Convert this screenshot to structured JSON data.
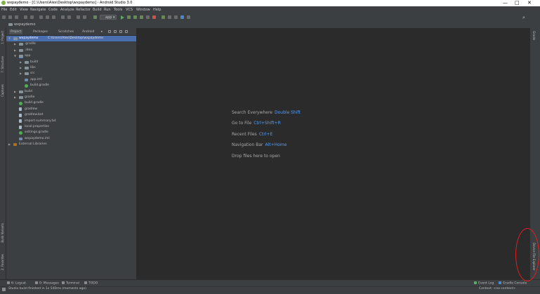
{
  "window": {
    "title": "wxpaydemo - [C:\\Users\\Alex\\Desktop\\wxpaydemo] - Android Studio 3.0",
    "minimize": "—",
    "maximize": "□",
    "close": "✕"
  },
  "menu": [
    "File",
    "Edit",
    "View",
    "Navigate",
    "Code",
    "Analyze",
    "Refactor",
    "Build",
    "Run",
    "Tools",
    "VCS",
    "Window",
    "Help"
  ],
  "toolbar": {
    "run_config": "app"
  },
  "breadcrumb": "wxpaydemo",
  "panel_tabs": {
    "project": "Project",
    "packages": "Packages",
    "scratches": "Scratches",
    "android": "Android"
  },
  "tree": [
    {
      "label": "wxpaydemo",
      "path": "C:\\Users\\Alex\\Desktop\\wxpaydemo",
      "depth": 0,
      "expanded": true,
      "icon": "module",
      "selected": true
    },
    {
      "label": ".gradle",
      "depth": 1,
      "expanded": false,
      "icon": "folder"
    },
    {
      "label": ".idea",
      "depth": 1,
      "expanded": false,
      "icon": "folder"
    },
    {
      "label": "app",
      "depth": 1,
      "expanded": true,
      "icon": "module"
    },
    {
      "label": "build",
      "depth": 2,
      "expanded": false,
      "icon": "folder"
    },
    {
      "label": "libs",
      "depth": 2,
      "expanded": false,
      "icon": "folder"
    },
    {
      "label": "src",
      "depth": 2,
      "expanded": false,
      "icon": "folder"
    },
    {
      "label": "app.iml",
      "depth": 2,
      "icon": "iml"
    },
    {
      "label": "build.gradle",
      "depth": 2,
      "icon": "gradle"
    },
    {
      "label": "build",
      "depth": 1,
      "expanded": false,
      "icon": "folder"
    },
    {
      "label": "gradle",
      "depth": 1,
      "expanded": false,
      "icon": "folder"
    },
    {
      "label": "build.gradle",
      "depth": 1,
      "icon": "gradle"
    },
    {
      "label": "gradlew",
      "depth": 1,
      "icon": "file"
    },
    {
      "label": "gradlew.bat",
      "depth": 1,
      "icon": "file"
    },
    {
      "label": "import-summary.txt",
      "depth": 1,
      "icon": "file"
    },
    {
      "label": "local.properties",
      "depth": 1,
      "icon": "file"
    },
    {
      "label": "settings.gradle",
      "depth": 1,
      "icon": "gradle"
    },
    {
      "label": "wxpaydemo.iml",
      "depth": 1,
      "icon": "iml"
    },
    {
      "label": "External Libraries",
      "depth": 0,
      "expanded": false,
      "icon": "library"
    }
  ],
  "editor_tips": [
    {
      "text": "Search Everywhere",
      "shortcut": "Double Shift"
    },
    {
      "text": "Go to File",
      "shortcut": "Ctrl+Shift+R"
    },
    {
      "text": "Recent Files",
      "shortcut": "Ctrl+E"
    },
    {
      "text": "Navigation Bar",
      "shortcut": "Alt+Home"
    },
    {
      "text": "Drop files here to open",
      "shortcut": ""
    }
  ],
  "left_tool_tabs": {
    "project": "1: Project",
    "structure": "7: Structure",
    "captures": "Captures",
    "build_variants": "Build Variants",
    "favorites": "2: Favorites"
  },
  "right_tool_tabs": {
    "gradle": "Gradle",
    "device_explorer": "Device File Explorer"
  },
  "bottom_tools": {
    "logcat": "6: Logcat",
    "messages": "0: Messages",
    "terminal": "Terminal",
    "todo": "TODO",
    "event_log": "Event Log",
    "gradle_console": "Gradle Console"
  },
  "status": {
    "message": "Studio build finished in 1s 540ms (moments ago)",
    "context": "Context: <no context>"
  },
  "colors": {
    "accent": "#4b6eaf",
    "shortcut": "#589df6",
    "annotation": "#e02020"
  }
}
